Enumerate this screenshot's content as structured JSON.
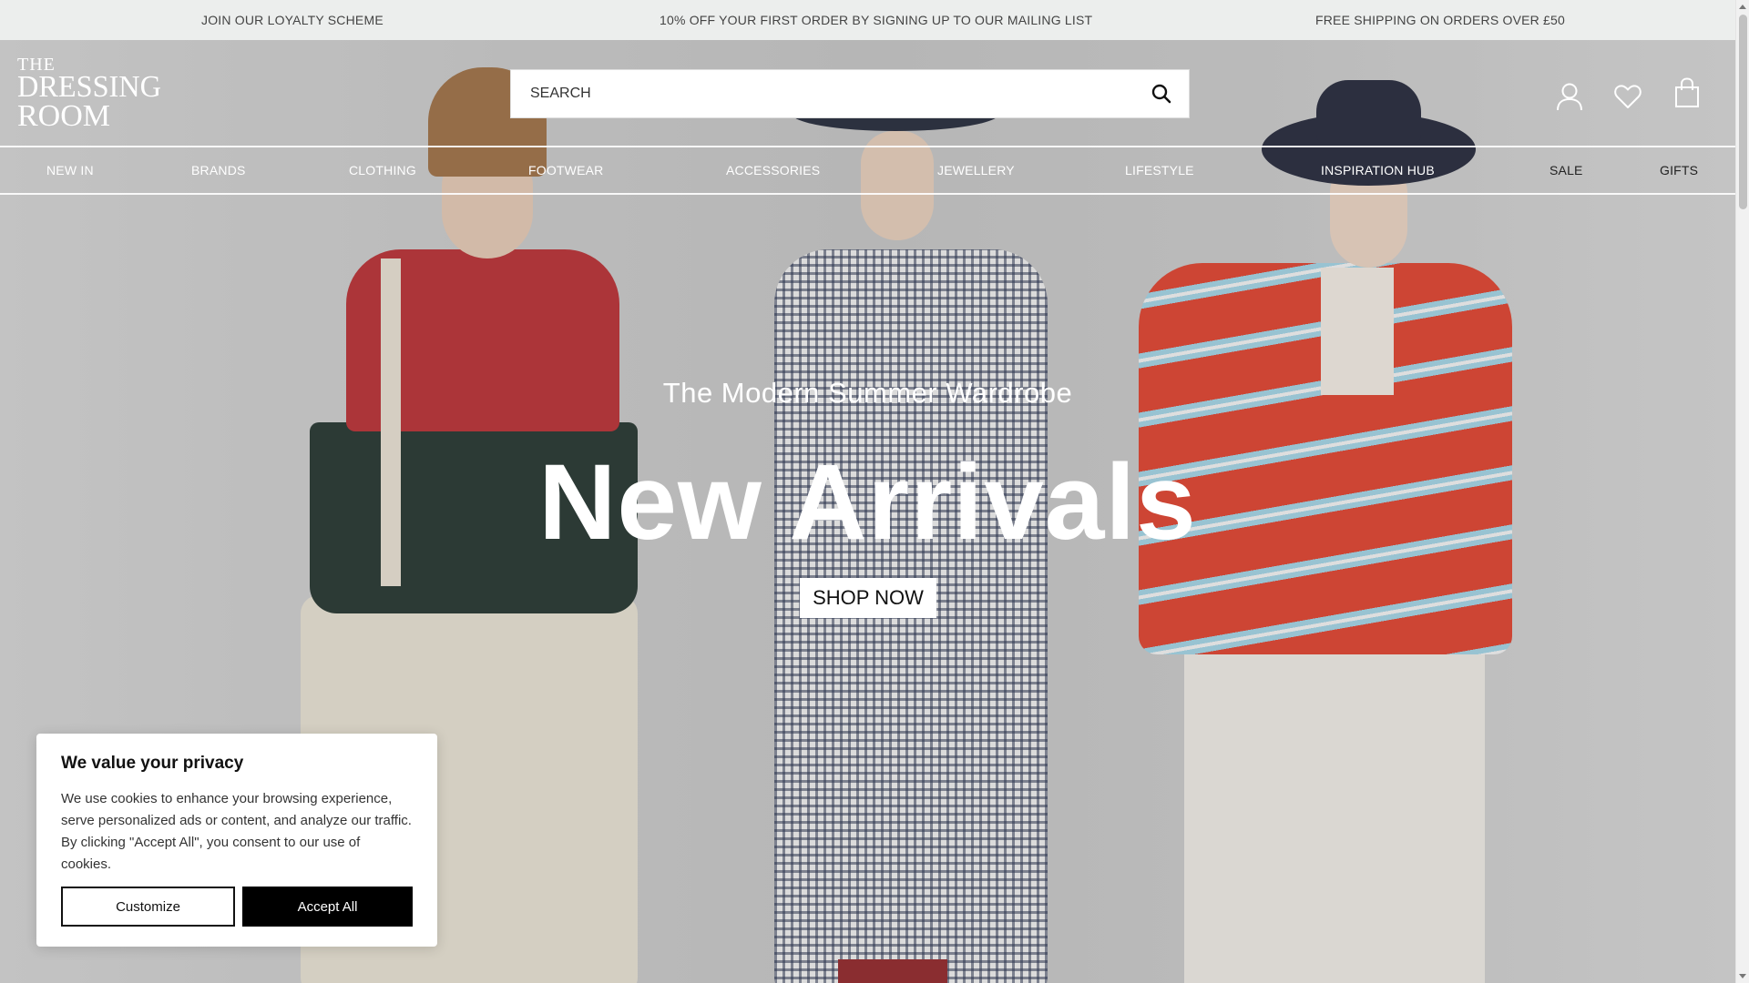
{
  "announcements": [
    "JOIN OUR LOYALTY SCHEME",
    "10% OFF YOUR FIRST ORDER BY SIGNING UP TO OUR MAILING LIST",
    "FREE SHIPPING ON ORDERS OVER £50"
  ],
  "logo": {
    "line1": "THE",
    "line2": "DRESSING",
    "line3": "ROOM"
  },
  "search": {
    "placeholder": "SEARCH",
    "icon": "search-icon"
  },
  "header_icons": [
    "account-icon",
    "wishlist-heart-icon",
    "shopping-bag-icon"
  ],
  "nav": {
    "items": [
      "NEW IN",
      "BRANDS",
      "CLOTHING",
      "FOOTWEAR",
      "ACCESSORIES",
      "JEWELLERY",
      "LIFESTYLE",
      "INSPIRATION HUB",
      "SALE",
      "GIFTS"
    ]
  },
  "hero": {
    "subtitle": "The Modern Summer Wardrobe",
    "title": "New Arrivals",
    "cta": "SHOP NOW"
  },
  "cookie": {
    "title": "We value your privacy",
    "body": "We use cookies to enhance your browsing experience, serve personalized ads or content, and analyze our traffic. By clicking \"Accept All\", you consent to our use of cookies.",
    "customize_label": "Customize",
    "accept_label": "Accept All"
  },
  "colors": {
    "announce_bg": "#eceeed",
    "accept_bg": "#000000",
    "text_white": "#ffffff"
  }
}
